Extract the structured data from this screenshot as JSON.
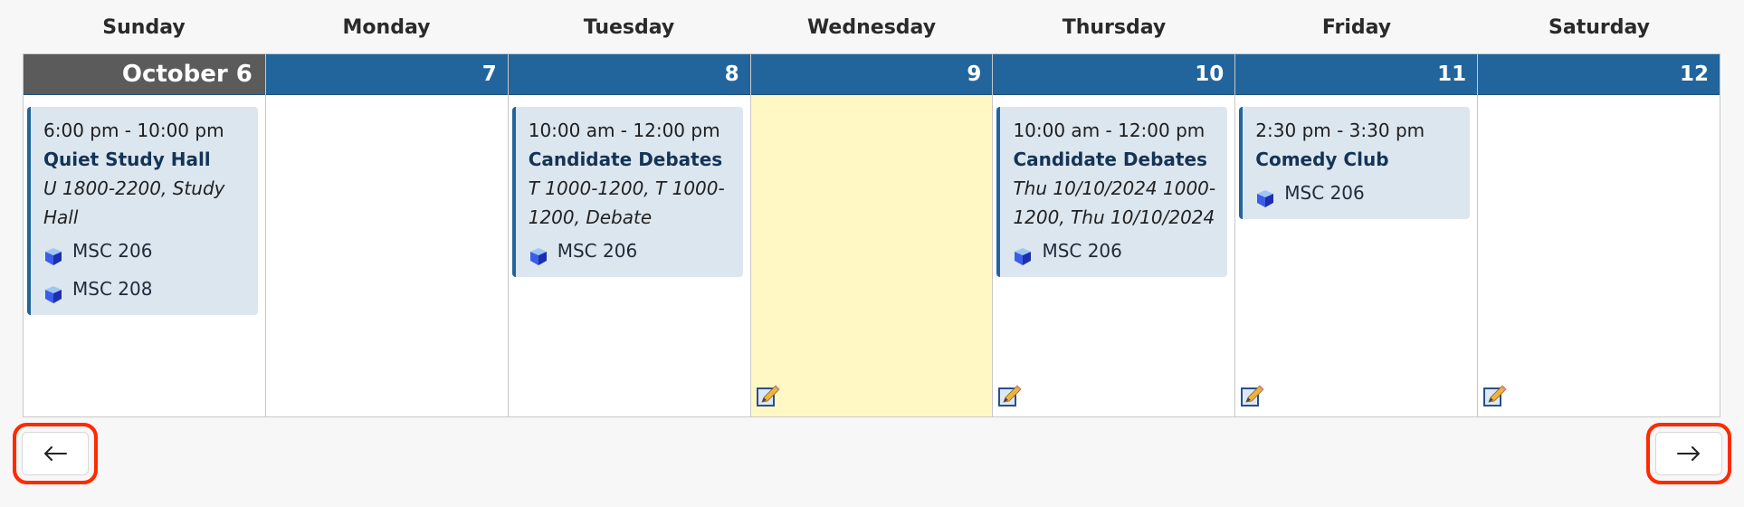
{
  "calendar": {
    "weekday_names": [
      "Sunday",
      "Monday",
      "Tuesday",
      "Wednesday",
      "Thursday",
      "Friday",
      "Saturday"
    ],
    "days": [
      {
        "label": "October 6",
        "is_today": false,
        "has_edit": false,
        "events": [
          {
            "time": "6:00 pm - 10:00 pm",
            "title": "Quiet Study Hall",
            "description": "U 1800-2200, Study Hall",
            "locations": [
              "MSC 206",
              "MSC 208"
            ]
          }
        ]
      },
      {
        "label": "7",
        "is_today": false,
        "has_edit": false,
        "events": []
      },
      {
        "label": "8",
        "is_today": false,
        "has_edit": false,
        "events": [
          {
            "time": "10:00 am - 12:00 pm",
            "title": "Candidate Debates",
            "description": "T 1000-1200, T 1000-1200, Debate",
            "locations": [
              "MSC 206"
            ]
          }
        ]
      },
      {
        "label": "9",
        "is_today": true,
        "has_edit": true,
        "events": []
      },
      {
        "label": "10",
        "is_today": false,
        "has_edit": true,
        "events": [
          {
            "time": "10:00 am - 12:00 pm",
            "title": "Candidate Debates",
            "description": "Thu 10/10/2024 1000-1200, Thu 10/10/2024",
            "locations": [
              "MSC 206"
            ]
          }
        ]
      },
      {
        "label": "11",
        "is_today": false,
        "has_edit": true,
        "events": [
          {
            "time": "2:30 pm - 3:30 pm",
            "title": "Comedy Club",
            "description": "",
            "locations": [
              "MSC 206"
            ]
          }
        ]
      },
      {
        "label": "12",
        "is_today": false,
        "has_edit": true,
        "events": []
      }
    ]
  },
  "navigation": {
    "prev_icon": "arrow-left-icon",
    "next_icon": "arrow-right-icon"
  },
  "icons": {
    "location": "cube-icon",
    "edit": "pencil-edit-icon"
  },
  "colors": {
    "header_blue": "#22659c",
    "first_header_gray": "#5b5b5b",
    "today_yellow": "#fff8c4",
    "event_bg": "#dce6ef",
    "highlight_red": "#ff2a00"
  }
}
